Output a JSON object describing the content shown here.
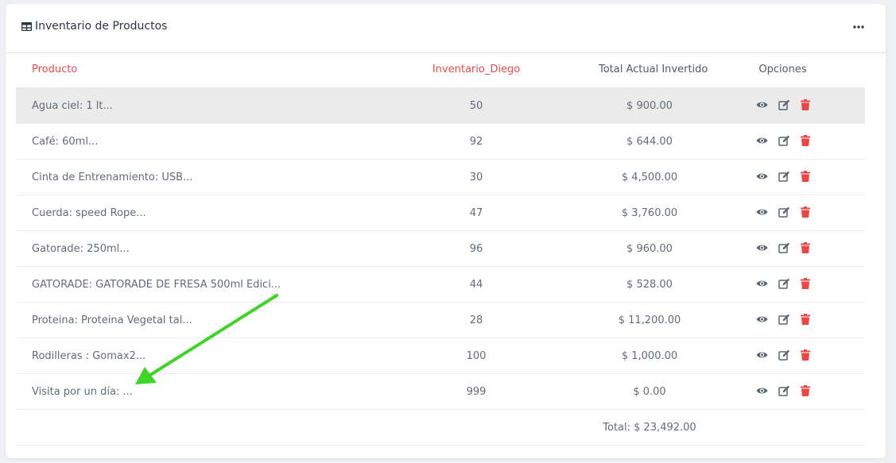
{
  "card": {
    "title": "Inventario de Productos",
    "more_icon": "ellipsis-horizontal-icon"
  },
  "table": {
    "headers": {
      "product": "Producto",
      "inventory": "Inventario_Diego",
      "total": "Total Actual Invertido",
      "options": "Opciones"
    },
    "rows": [
      {
        "product": "Agua ciel: 1 lt...",
        "qty": "50",
        "total": "$ 900.00"
      },
      {
        "product": "Café: 60ml...",
        "qty": "92",
        "total": "$ 644.00"
      },
      {
        "product": "Cinta de Entrenamiento: USB...",
        "qty": "30",
        "total": "$ 4,500.00"
      },
      {
        "product": "Cuerda: speed Rope...",
        "qty": "47",
        "total": "$ 3,760.00"
      },
      {
        "product": "Gatorade: 250ml...",
        "qty": "96",
        "total": "$ 960.00"
      },
      {
        "product": "GATORADE: GATORADE DE FRESA 500ml Edici...",
        "qty": "44",
        "total": "$ 528.00"
      },
      {
        "product": "Proteina: Proteina Vegetal tal...",
        "qty": "28",
        "total": "$ 11,200.00"
      },
      {
        "product": "Rodilleras : Gomax2...",
        "qty": "100",
        "total": "$ 1,000.00"
      },
      {
        "product": "Visita por un día: ...",
        "qty": "999",
        "total": "$ 0.00"
      }
    ],
    "footer_total": "Total: $ 23,492.00",
    "action_icons": [
      "eye-icon",
      "edit-icon",
      "trash-icon"
    ]
  },
  "colors": {
    "accent_red": "#ee4a4a",
    "trash": "#ef4444",
    "highlight_row": "#ebebeb",
    "arrow": "#3fd427"
  }
}
